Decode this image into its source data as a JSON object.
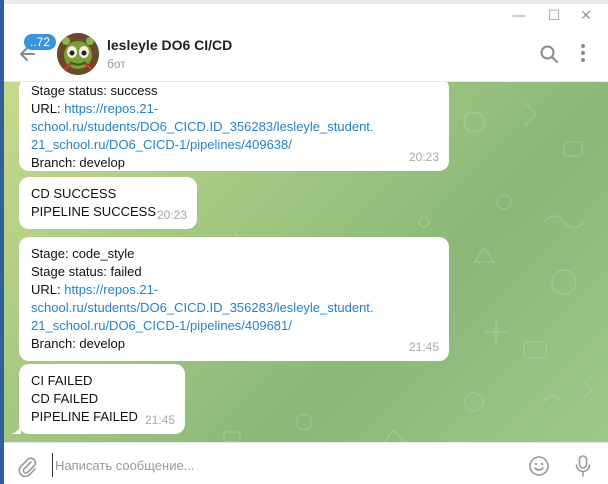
{
  "window": {
    "minimize_glyph": "—",
    "maximize_glyph": "☐",
    "close_glyph": "✕"
  },
  "header": {
    "unread_count": "..72",
    "title": "lesleyle DO6 CI/CD",
    "subtitle": "бот"
  },
  "messages": [
    {
      "lines": [
        "Stage status: success"
      ],
      "url_label": "URL: ",
      "url_lines": [
        "https://repos.21-",
        "school.ru/students/DO6_CICD.ID_356283/lesleyle_student.",
        "21_school.ru/DO6_CICD-1/pipelines/409638/"
      ],
      "after": [
        "Branch: develop"
      ],
      "time": "20:23"
    },
    {
      "lines": [
        "CD SUCCESS",
        "PIPELINE SUCCESS"
      ],
      "time": "20:23"
    },
    {
      "lines": [
        "Stage: code_style",
        "Stage status: failed"
      ],
      "url_label": "URL: ",
      "url_lines": [
        "https://repos.21-",
        "school.ru/students/DO6_CICD.ID_356283/lesleyle_student.",
        "21_school.ru/DO6_CICD-1/pipelines/409681/"
      ],
      "after": [
        "Branch: develop"
      ],
      "time": "21:45"
    },
    {
      "lines": [
        "CI FAILED",
        "CD FAILED",
        "PIPELINE FAILED"
      ],
      "time": "21:45"
    }
  ],
  "composer": {
    "placeholder": "Написать сообщение..."
  },
  "colors": {
    "accent": "#3a94d8",
    "link": "#2481cc",
    "chat_bg": "#a4c882"
  },
  "icons": [
    "back-arrow-icon",
    "search-icon",
    "more-vertical-icon",
    "paperclip-icon",
    "emoji-icon",
    "microphone-icon"
  ]
}
